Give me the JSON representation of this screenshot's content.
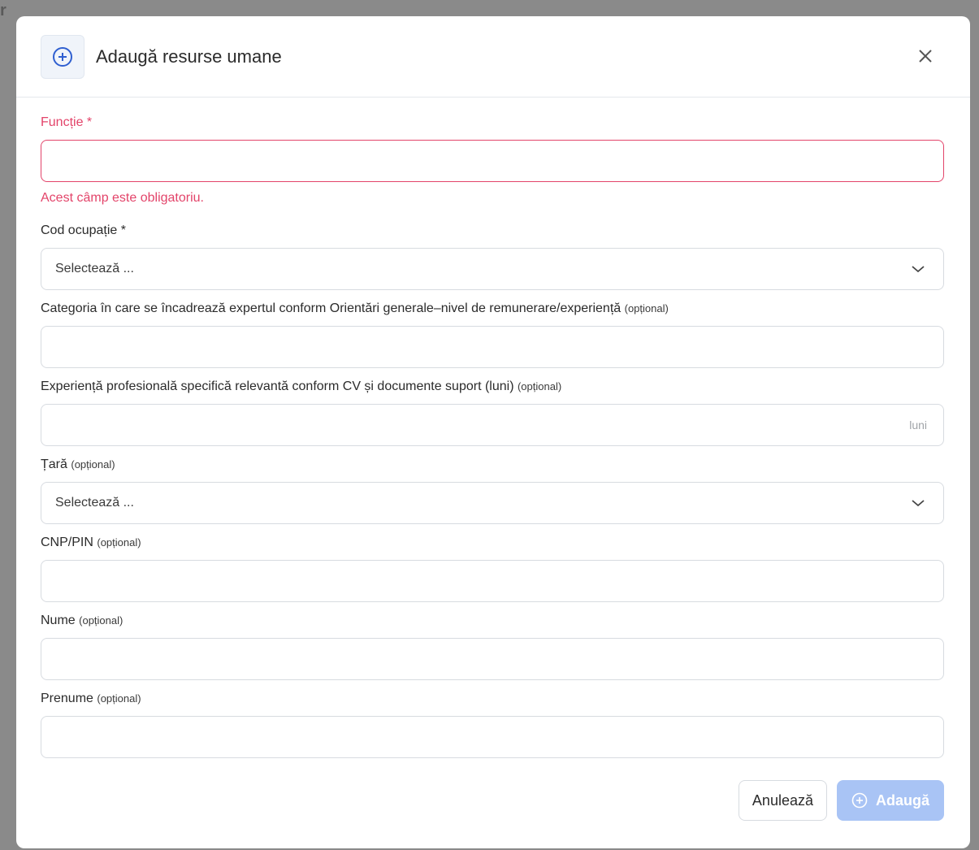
{
  "backdrop": {
    "fragment": "r"
  },
  "modal": {
    "title": "Adaugă resurse umane",
    "fields": [
      {
        "label": "Funcție *",
        "error": "Acest câmp este obligatoriu.",
        "value": ""
      },
      {
        "label": "Cod ocupație *",
        "value": "Selectează ..."
      },
      {
        "label": "Categoria în care se încadrează expertul conform Orientări generale–nivel de remunerare/experiență",
        "optional": "(opțional)",
        "value": ""
      },
      {
        "label": "Experiență profesională specifică relevantă conform CV și documente suport (luni)",
        "optional": "(opțional)",
        "value": "",
        "suffix": "luni"
      },
      {
        "label": "Țară",
        "optional": "(opțional)",
        "value": "Selectează ..."
      },
      {
        "label": "CNP/PIN",
        "optional": "(opțional)",
        "value": ""
      },
      {
        "label": "Nume",
        "optional": "(opțional)",
        "value": ""
      },
      {
        "label": "Prenume",
        "optional": "(opțional)",
        "value": ""
      }
    ],
    "buttons": {
      "cancel": "Anulează",
      "add": "Adaugă"
    }
  },
  "colors": {
    "error": "#e3446a",
    "primary_icon": "#2f5fd0",
    "add_button_disabled": "#a9c4f5"
  },
  "icons": {
    "header": "plus-circle-icon",
    "close": "close-icon",
    "dropdown": "chevron-down-icon",
    "add": "plus-circle-icon"
  }
}
